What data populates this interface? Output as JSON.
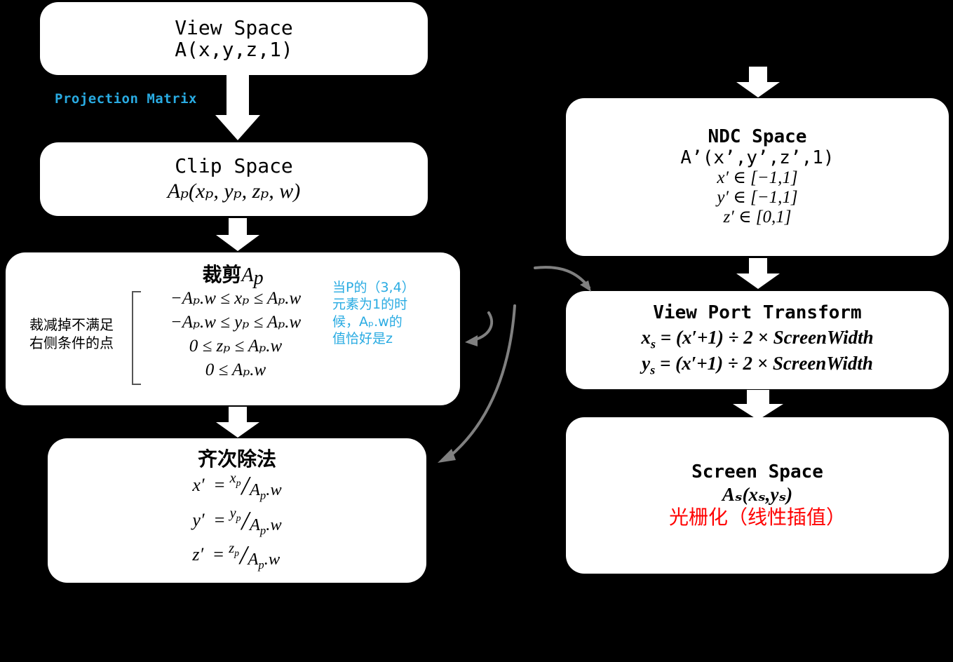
{
  "meta": {
    "background_color": "#000000",
    "box_fill": "#ffffff",
    "accent_cyan": "#29ABE2",
    "accent_red": "#FF0000",
    "arrow_gray": "#808080"
  },
  "nodes": {
    "view_space": {
      "title": "View Space",
      "point": "A(x,y,z,1)"
    },
    "projection_label": "Projection Matrix",
    "clip_space": {
      "title": "Clip Space",
      "point_A": "A",
      "point_sub": "p",
      "point_rest": "(x",
      "formula": "Aₚ(xₚ, yₚ, zₚ, w)"
    },
    "clipping": {
      "title_cn": "裁剪",
      "title_var": "A",
      "title_var_sub": "p",
      "left_note_line1": "裁减掉不满足",
      "left_note_line2": "右侧条件的点",
      "inequalities": [
        "−Aₚ.w ≤ xₚ ≤ Aₚ.w",
        "−Aₚ.w ≤ yₚ ≤ Aₚ.w",
        "0 ≤ zₚ ≤ Aₚ.w",
        "0 ≤ Aₚ.w"
      ],
      "cyan_note": [
        "当P的（3,4）",
        "元素为1的时",
        "候，Aₚ.w的",
        "值恰好是z"
      ]
    },
    "homogeneous_division": {
      "title": "齐次除法",
      "rows": [
        {
          "lhs": "x′",
          "eq": "=",
          "num": "x",
          "num_sub": "p",
          "den": "A",
          "den_sub": "p",
          "den_rest": ".w"
        },
        {
          "lhs": "y′",
          "eq": "=",
          "num": "y",
          "num_sub": "p",
          "den": "A",
          "den_sub": "p",
          "den_rest": ".w"
        },
        {
          "lhs": "z′",
          "eq": "=",
          "num": "z",
          "num_sub": "p",
          "den": "A",
          "den_sub": "p",
          "den_rest": ".w"
        }
      ]
    },
    "ndc_space": {
      "title": "NDC Space",
      "point": "A’(x’,y’,z’,1)",
      "range_x": "x′ ∈ [−1,1]",
      "range_y": "y′ ∈ [−1,1]",
      "range_z": "z′ ∈ [0,1]"
    },
    "viewport_transform": {
      "title": "View Port Transform",
      "eq_x": "xₛ = (x′+1) ÷ 2 × ScreenWidth",
      "eq_y": "yₛ = (x′+1) ÷ 2 × ScreenWidth",
      "eq_x_parts": {
        "lhs": "x",
        "lhs_sub": "s",
        "rhs": "= (x′+1) ÷ 2 × ScreenWidth"
      },
      "eq_y_parts": {
        "lhs": "y",
        "lhs_sub": "s",
        "rhs": "= (x′+1) ÷ 2 × ScreenWidth"
      }
    },
    "screen_space": {
      "title": "Screen Space",
      "point_A": "A",
      "point_sub": "s",
      "point_rest": "(x",
      "point": "Aₛ(xₛ,yₛ)",
      "raster_note": "光栅化（线性插值）"
    }
  },
  "connectors": {
    "view_to_clip": "down-block-arrow",
    "clip_to_clipping": "down-block-arrow-small",
    "clipping_to_division": "down-block-arrow-small",
    "top_into_ndc": "down-block-arrow",
    "ndc_to_viewport": "down-block-arrow-small",
    "viewport_to_screen": "down-block-arrow",
    "curved_1": "gray-curve-to-viewport",
    "curved_2": "gray-curve-to-clipping-note",
    "curved_3": "gray-curve-to-division"
  }
}
